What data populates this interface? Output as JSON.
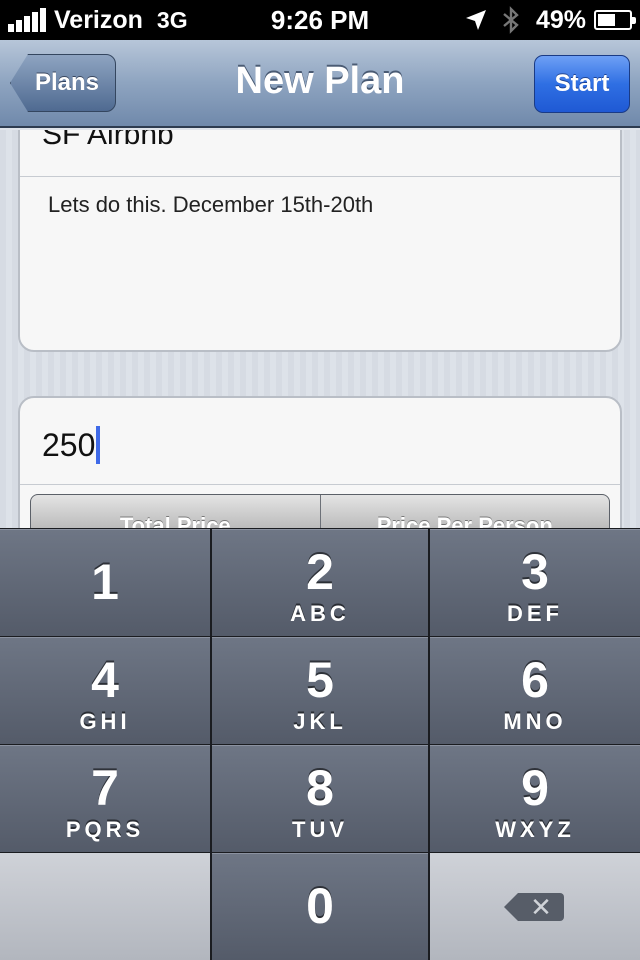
{
  "status_bar": {
    "carrier": "Verizon",
    "network": "3G",
    "time": "9:26 PM",
    "battery": "49%",
    "battery_level": 0.49
  },
  "nav": {
    "back_label": "Plans",
    "title": "New Plan",
    "start_label": "Start"
  },
  "plan": {
    "title": "SF Airbnb",
    "notes": "Lets do this. December 15th-20th"
  },
  "price": {
    "value": "250",
    "segments": [
      "Total Price",
      "Price Per Person"
    ]
  },
  "keypad": {
    "keys": [
      {
        "digit": "1",
        "letters": ""
      },
      {
        "digit": "2",
        "letters": "ABC"
      },
      {
        "digit": "3",
        "letters": "DEF"
      },
      {
        "digit": "4",
        "letters": "GHI"
      },
      {
        "digit": "5",
        "letters": "JKL"
      },
      {
        "digit": "6",
        "letters": "MNO"
      },
      {
        "digit": "7",
        "letters": "PQRS"
      },
      {
        "digit": "8",
        "letters": "TUV"
      },
      {
        "digit": "9",
        "letters": "WXYZ"
      },
      {
        "digit": "0",
        "letters": ""
      }
    ],
    "delete_icon": "backspace-icon"
  }
}
